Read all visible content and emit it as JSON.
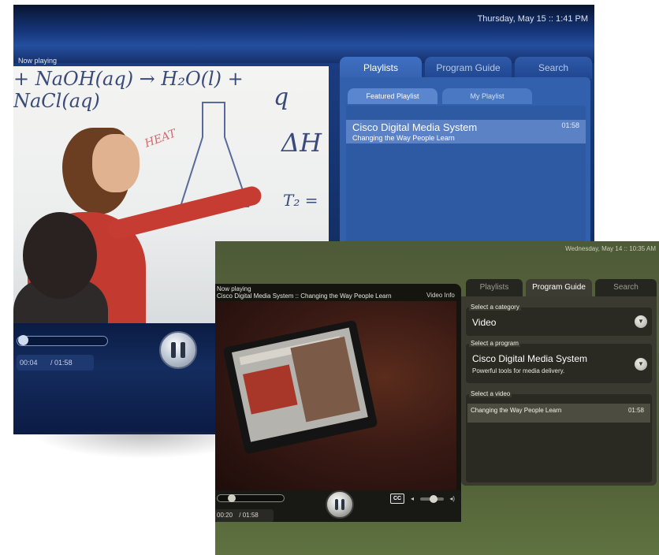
{
  "back_window": {
    "date_time": "Thursday, May 15 :: 1:41 PM",
    "now_playing_label": "Now playing",
    "whiteboard": {
      "equation": "+ NaOH(aq) → H₂O(l) + NaCl(aq)",
      "heat": "HEAT",
      "delta": "ΔH",
      "q": "q",
      "t": "T₂ ="
    },
    "tabs": [
      "Playlists",
      "Program Guide",
      "Search"
    ],
    "subtabs": [
      "Featured Playlist",
      "My Playlist"
    ],
    "playlist_item": {
      "title": "Cisco Digital Media System",
      "subtitle": "Changing the Way People Learn",
      "duration": "01:58"
    },
    "elapsed": "00:04",
    "total": "/ 01:58",
    "progress_fraction": 0.03
  },
  "front_window": {
    "date_time": "Wednesday, May 14 :: 10:35 AM",
    "now_playing_label": "Now playing",
    "now_playing_title": "Cisco Digital Media System :: Changing the Way People Learn",
    "video_info_link": "Video Info",
    "tabs": [
      "Playlists",
      "Program Guide",
      "Search"
    ],
    "category": {
      "label": "Select a category",
      "value": "Video"
    },
    "program": {
      "label": "Select a program",
      "value": "Cisco Digital Media System",
      "description": "Powerful tools for media delivery."
    },
    "video_select": {
      "label": "Select a video",
      "title": "Changing the Way People Learn",
      "duration": "01:58"
    },
    "elapsed": "00:20",
    "total": "/ 01:58",
    "cc_label": "CC",
    "progress_fraction": 0.17
  },
  "icons": [
    "pause-icon",
    "chevron-down-icon",
    "volume-low-icon",
    "volume-high-icon",
    "closed-captions-icon"
  ],
  "colors": {
    "back_accent": "#3360ac",
    "front_accent": "#4e5a38"
  }
}
